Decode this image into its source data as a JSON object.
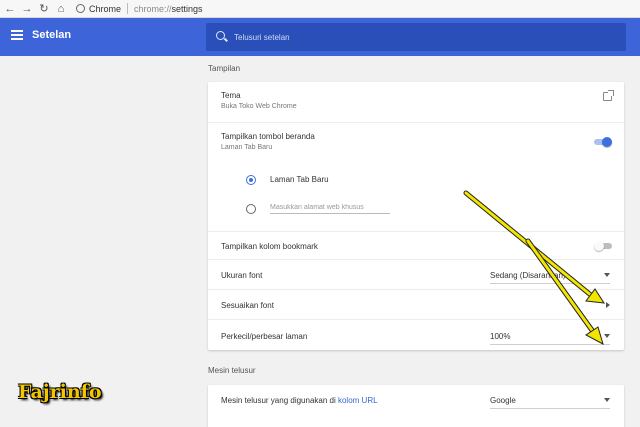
{
  "browser": {
    "tab_label": "Chrome",
    "url_scheme": "chrome://",
    "url_path": "settings"
  },
  "header": {
    "title": "Setelan",
    "search_placeholder": "Telusuri setelan"
  },
  "appearance": {
    "section_title": "Tampilan",
    "theme_label": "Tema",
    "theme_sub": "Buka Toko Web Chrome",
    "home_button_label": "Tampilkan tombol beranda",
    "home_button_sub": "Laman Tab Baru",
    "home_button_on": true,
    "radio_new_tab_label": "Laman Tab Baru",
    "radio_custom_placeholder": "Masukkan alamat web khusus",
    "bookmark_bar_label": "Tampilkan kolom bookmark",
    "bookmark_bar_on": false,
    "font_size_label": "Ukuran font",
    "font_size_value": "Sedang (Disarankan)",
    "customize_fonts_label": "Sesuaikan font",
    "zoom_label": "Perkecil/perbesar laman",
    "zoom_value": "100%"
  },
  "search_engine": {
    "section_title": "Mesin telusur",
    "label_prefix": "Mesin telusur yang digunakan di",
    "label_link": "kolom URL",
    "value": "Google"
  },
  "watermark": "Fajrinfo",
  "colors": {
    "header_blue": "#3d64d8",
    "toggle_on": "#3d6fe0",
    "annotation_arrow": "#f2e600"
  },
  "icons": [
    "back-arrow-icon",
    "forward-arrow-icon",
    "reload-icon",
    "home-icon",
    "menu-icon",
    "search-icon",
    "external-link-icon"
  ]
}
